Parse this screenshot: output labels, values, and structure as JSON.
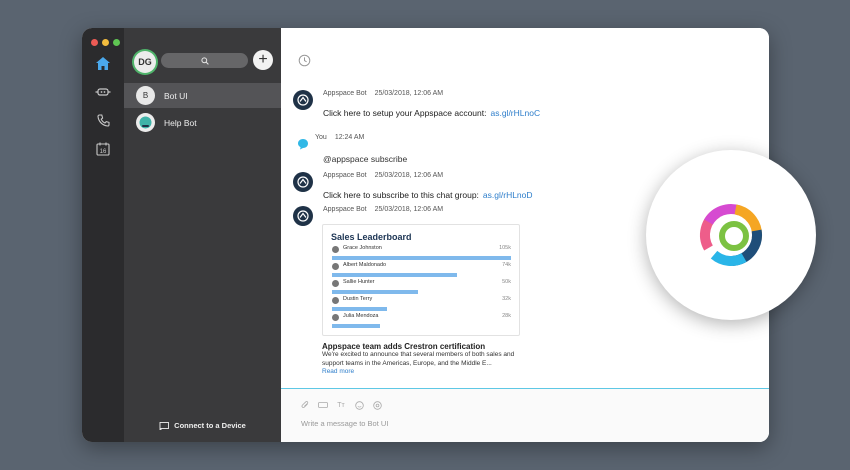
{
  "rail": {
    "items": [
      "home-icon",
      "bot-icon",
      "phone-icon",
      "calendar-icon"
    ],
    "calendar_day": "16",
    "colors": {
      "active": "#4aa8ec",
      "inactive": "#c8c8c8"
    }
  },
  "panel": {
    "avatar_initials": "DG",
    "spaces": [
      {
        "initial": "B",
        "label": "Bot UI",
        "selected": true
      },
      {
        "initial": "",
        "label": "Help Bot",
        "selected": false
      }
    ],
    "connect_label": "Connect to a Device"
  },
  "messages": [
    {
      "sender": "Appspace Bot",
      "time": "25/03/2018, 12:06 AM",
      "text": "Click here to setup your Appspace account:",
      "link": "as.gl/rHLnoC"
    },
    {
      "sender": "You",
      "time": "12:24 AM",
      "text": "@appspace subscribe",
      "link": ""
    },
    {
      "sender": "Appspace Bot",
      "time": "25/03/2018, 12:06 AM",
      "text": "Click here to subscribe to this chat group:",
      "link": "as.gl/rHLnoD"
    },
    {
      "sender": "Appspace Bot",
      "time": "25/03/2018, 12:06 AM",
      "text": "",
      "link": ""
    }
  ],
  "leaderboard": {
    "title": "Sales Leaderboard",
    "rows": [
      {
        "name": "Grace Johnston",
        "value": "105k",
        "fraction": 1.0
      },
      {
        "name": "Albert Maldonado",
        "value": "74k",
        "fraction": 0.7
      },
      {
        "name": "Sallie Hunter",
        "value": "50k",
        "fraction": 0.48
      },
      {
        "name": "Dustin Terry",
        "value": "32k",
        "fraction": 0.31
      },
      {
        "name": "Julia Mendoza",
        "value": "28k",
        "fraction": 0.27
      }
    ]
  },
  "news": {
    "title": "Appspace team adds Crestron certification",
    "text": "We're excited to announce that several members of both sales and support teams in the Americas, Europe, and the Middle E...",
    "more": "Read more"
  },
  "compose": {
    "tools": [
      "attach-icon",
      "video-icon",
      "text-format-icon",
      "emoji-icon",
      "mention-icon"
    ],
    "tt_label": "Tт",
    "placeholder": "Write a message to Bot UI"
  },
  "colors": {
    "accent": "#2e7ecb",
    "bot_avatar": "#1f3247",
    "bar": "#7fb9ec",
    "compose_border": "#5ec8e5"
  }
}
